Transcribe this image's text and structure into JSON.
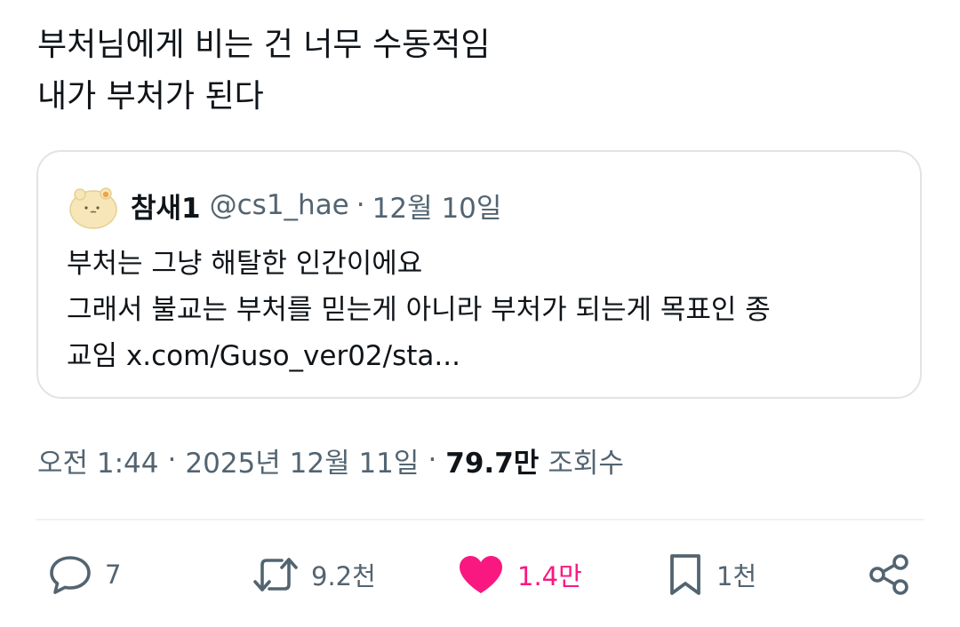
{
  "tweet": {
    "lines": [
      "부처님에게 비는 건 너무 수동적임",
      "내가 부처가 된다"
    ]
  },
  "quote": {
    "author_name": "참새1",
    "author_handle": "@cs1_hae",
    "date": "12월 10일",
    "separator": "·",
    "body_lines": [
      "부처는 그냥 해탈한 인간이에요",
      "그래서 불교는 부처를 믿는게 아니라 부처가 되는게 목표인 종"
    ],
    "last_line_prefix": "교임",
    "link_text": "x.com/Guso_ver02/sta..."
  },
  "meta": {
    "time": "오전 1:44",
    "date": "2025년 12월 11일",
    "separator": "·",
    "views_count": "79.7만",
    "views_label": "조회수"
  },
  "actions": {
    "reply_count": "7",
    "repost_count": "9.2천",
    "like_count": "1.4만",
    "bookmark_count": "1천"
  },
  "icons": {
    "reply": "reply-icon",
    "repost": "repost-icon",
    "like": "heart-icon",
    "bookmark": "bookmark-icon",
    "share": "share-icon",
    "avatar": "hamster-avatar"
  },
  "colors": {
    "text_primary": "#0f1419",
    "text_secondary": "#536471",
    "like_pink": "#f91880",
    "border": "#dfe4e8"
  }
}
